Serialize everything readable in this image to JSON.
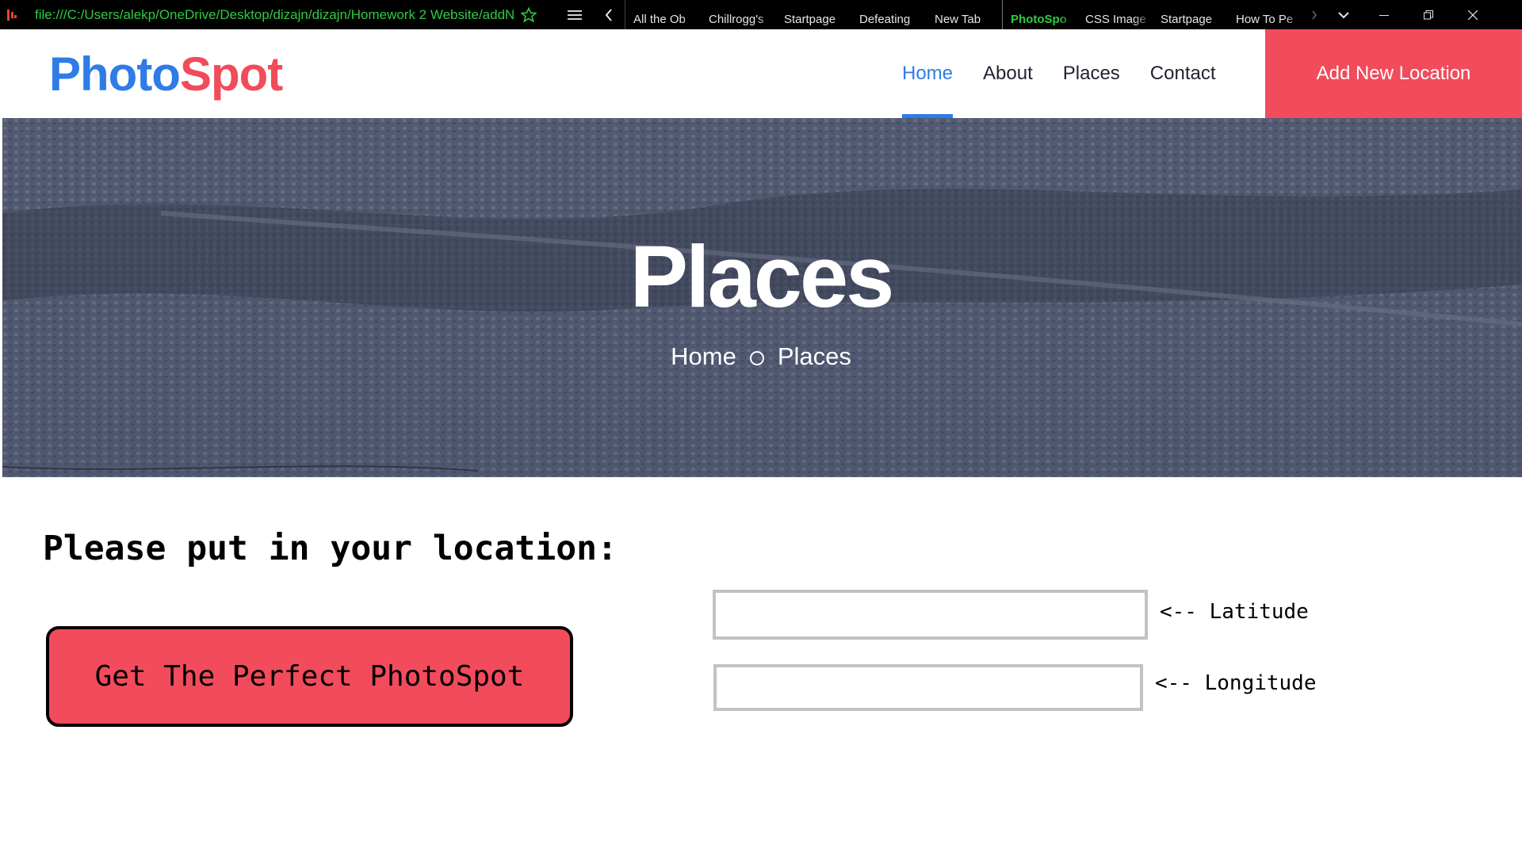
{
  "browser": {
    "url": "file:///C:/Users/alekp/OneDrive/Desktop/dizajn/dizajn/Homework 2 Website/addN",
    "tabs": [
      {
        "label": "All the Ob",
        "active": false
      },
      {
        "label": "Chillrogg's",
        "active": false
      },
      {
        "label": "Startpage",
        "active": false
      },
      {
        "label": "Defeating",
        "active": false
      },
      {
        "label": "New Tab",
        "active": false
      },
      {
        "label": "PhotoSpo",
        "active": true
      },
      {
        "label": "CSS Image",
        "active": false
      },
      {
        "label": "Startpage",
        "active": false
      },
      {
        "label": "How To Pe",
        "active": false
      }
    ],
    "accent_color": "#2ecc40",
    "icons": {
      "logo": "browser-logo-icon",
      "star": "bookmark-star-icon",
      "menu": "hamburger-menu-icon",
      "back": "chevron-left-icon",
      "next": "chevron-right-icon",
      "dropdown": "chevron-down-icon",
      "minimize": "minimize-icon",
      "restore": "restore-icon",
      "close": "close-icon"
    }
  },
  "site": {
    "logo": {
      "part1": "Photo",
      "part2": "Spot"
    },
    "nav": [
      {
        "label": "Home",
        "active": true
      },
      {
        "label": "About",
        "active": false
      },
      {
        "label": "Places",
        "active": false
      },
      {
        "label": "Contact",
        "active": false
      }
    ],
    "cta_label": "Add New Location",
    "colors": {
      "brand_blue": "#2f7be8",
      "brand_red": "#f24b5b",
      "nav_text": "#1f2233"
    }
  },
  "hero": {
    "title": "Places",
    "breadcrumb": [
      "Home",
      "Places"
    ]
  },
  "form": {
    "heading": "Please put in your location:",
    "button_label": "Get The Perfect PhotoSpot",
    "latitude": {
      "value": "",
      "label": "<-- Latitude"
    },
    "longitude": {
      "value": "",
      "label": "<-- Longitude"
    }
  }
}
